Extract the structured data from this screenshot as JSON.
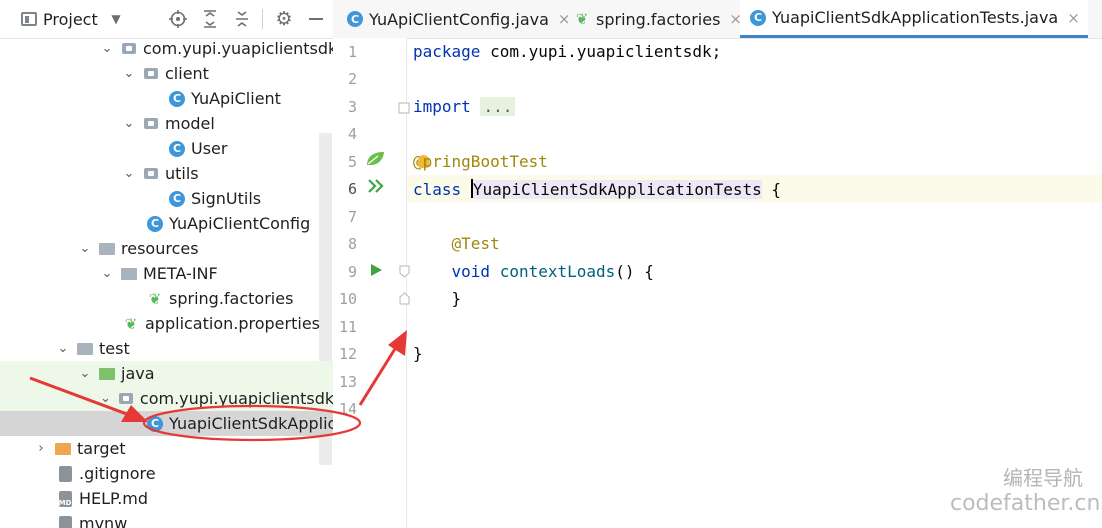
{
  "panel": {
    "title": "Project",
    "dropdown_icon": "chevron-down-icon",
    "toolbar_icons": [
      "locate-icon",
      "expand-all-icon",
      "collapse-all-icon",
      "gear-icon",
      "minimize-icon"
    ]
  },
  "tree": [
    {
      "label": "com.yupi.yuapiclientsdk",
      "icon": "package-icon",
      "expanded": true
    },
    {
      "label": "client",
      "icon": "package-icon",
      "expanded": true
    },
    {
      "label": "YuApiClient",
      "icon": "class-icon"
    },
    {
      "label": "model",
      "icon": "package-icon",
      "expanded": true
    },
    {
      "label": "User",
      "icon": "class-icon"
    },
    {
      "label": "utils",
      "icon": "package-icon",
      "expanded": true
    },
    {
      "label": "SignUtils",
      "icon": "class-icon"
    },
    {
      "label": "YuApiClientConfig",
      "icon": "class-icon"
    },
    {
      "label": "resources",
      "icon": "folder-icon",
      "expanded": true
    },
    {
      "label": "META-INF",
      "icon": "folder-icon",
      "expanded": true
    },
    {
      "label": "spring.factories",
      "icon": "spring-icon"
    },
    {
      "label": "application.properties",
      "icon": "spring-config-icon"
    },
    {
      "label": "test",
      "icon": "folder-icon",
      "expanded": true
    },
    {
      "label": "java",
      "icon": "source-folder-icon",
      "expanded": true
    },
    {
      "label": "com.yupi.yuapiclientsdk",
      "icon": "package-icon",
      "expanded": true
    },
    {
      "label": "YuapiClientSdkApplica",
      "icon": "test-class-icon",
      "selected": true
    },
    {
      "label": "target",
      "icon": "target-folder-icon",
      "expanded": false
    },
    {
      "label": ".gitignore",
      "icon": "file-icon"
    },
    {
      "label": "HELP.md",
      "icon": "markdown-icon"
    },
    {
      "label": "mvnw",
      "icon": "file-icon"
    }
  ],
  "markdown_badge": "MD",
  "class_badge": "C",
  "tabs": [
    {
      "label": "YuApiClientConfig.java",
      "icon": "class-icon",
      "active": false
    },
    {
      "label": "spring.factories",
      "icon": "spring-icon",
      "active": false
    },
    {
      "label": "YuapiClientSdkApplicationTests.java",
      "icon": "test-class-icon",
      "active": true
    }
  ],
  "tab_close": "×",
  "line_numbers": [
    "1",
    "2",
    "3",
    "4",
    "5",
    "6",
    "7",
    "8",
    "9",
    "10",
    "11",
    "12",
    "13",
    "14"
  ],
  "code": {
    "l1_kw": "package",
    "l1_rest": " com.yupi.yuapiclientsdk;",
    "l3_kw": "import",
    "l3_fold": "...",
    "l6_at": "@",
    "l6_rest": "pringBootTest",
    "l7_kw": "class",
    "l7_name": "YuapiClientSdkApplicationTests",
    "l7_brace": " {",
    "l9_ann": "@Test",
    "l10_kw": "void",
    "l10_fn": "contextLoads",
    "l10_rest": "() {",
    "l11": "}",
    "l13": "}"
  },
  "watermark": {
    "line1": "编程导航",
    "line2": "codefather.cn"
  },
  "colors": {
    "annotation_arrow": "#e53935",
    "keyword": "#0033b3",
    "annotation": "#9e880d",
    "tab_underline": "#4083c9"
  }
}
